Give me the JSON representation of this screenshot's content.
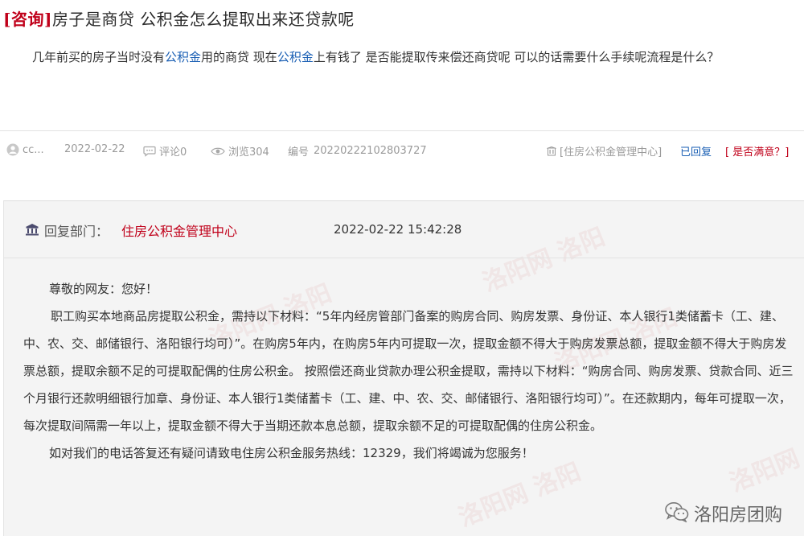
{
  "question": {
    "tag": "[咨询]",
    "title": "房子是商贷 公积金怎么提取出来还贷款呢",
    "body": {
      "p1": "几年前买的房子当时没有",
      "kw1": "公积金",
      "p2": "用的商贷 现在",
      "kw2": "公积金",
      "p3": "上有钱了 是否能提取传来偿还商贷呢 可以的话需要什么手续呢流程是什么？"
    }
  },
  "meta": {
    "author": "cc...",
    "date": "2022-02-22",
    "comments": "评论0",
    "views": "浏览304",
    "serial_label": "编号",
    "serial": "20220222102803727",
    "department": "[住房公积金管理中心]",
    "status": "已回复",
    "satisfaction": "[ 是否满意？]"
  },
  "reply": {
    "dept_label": "回复部门：",
    "dept_name": "住房公积金管理中心",
    "time": "2022-02-22 15:42:28",
    "greeting": "尊敬的网友：您好！",
    "paragraph": "职工购买本地商品房提取公积金，需持以下材料：“5年内经房管部门备案的购房合同、购房发票、身份证、本人银行1类储蓄卡（工、建、中、农、交、邮储银行、洛阳银行均可）”。在购房5年内，在购房5年内可提取一次，提取金额不得大于购房发票总额，提取金额不得大于购房发票总额，提取余额不足的可提取配偶的住房公积金。 按照偿还商业贷款办理公积金提取，需持以下材料：“购房合同、购房发票、贷款合同、近三个月银行还款明细银行加章、身份证、本人银行1类储蓄卡（工、建、中、农、交、邮储银行、洛阳银行均可）”。在还款期内，每年可提取一次，每次提取间隔需一年以上，提取金额不得大于当期还款本息总额，提取余额不足的可提取配偶的住房公积金。",
    "closing": "如对我们的电话答复还有疑问请致电住房公积金服务热线：12329，我们将竭诚为您服务！"
  },
  "watermark": {
    "brand": "洛阳房团购"
  },
  "colors": {
    "accent_red": "#c0001a",
    "link_blue": "#1a5fb4",
    "meta_gray": "#9a9a9a",
    "reply_bg": "#f4f4f4"
  }
}
